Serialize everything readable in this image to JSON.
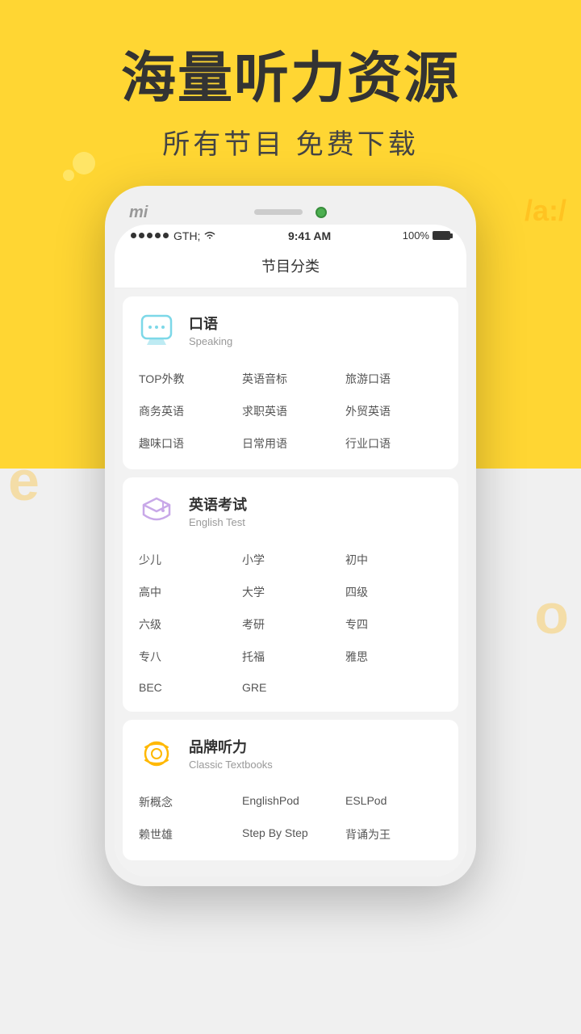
{
  "background": {
    "yellow": "#FFD633",
    "deco_phonetic": "/a:/"
  },
  "header": {
    "title": "海量听力资源",
    "subtitle": "所有节目  免费下载"
  },
  "phone": {
    "mi_logo": "mi",
    "status_bar": {
      "time": "9:41 AM",
      "battery": "100%"
    },
    "page_title": "节目分类",
    "categories": [
      {
        "id": "speaking",
        "title_cn": "口语",
        "title_en": "Speaking",
        "icon_type": "speaking",
        "items": [
          "TOP外教",
          "英语音标",
          "旅游口语",
          "商务英语",
          "求职英语",
          "外贸英语",
          "趣味口语",
          "日常用语",
          "行业口语"
        ]
      },
      {
        "id": "english-test",
        "title_cn": "英语考试",
        "title_en": "English Test",
        "icon_type": "exam",
        "items": [
          "少儿",
          "小学",
          "初中",
          "高中",
          "大学",
          "四级",
          "六级",
          "考研",
          "专四",
          "专八",
          "托福",
          "雅思",
          "BEC",
          "GRE",
          ""
        ]
      },
      {
        "id": "brand",
        "title_cn": "品牌听力",
        "title_en": "Classic Textbooks",
        "icon_type": "brand",
        "items": [
          "新概念",
          "EnglishPod",
          "ESLPod",
          "赖世雄",
          "Step By Step",
          "背诵为王"
        ]
      }
    ]
  },
  "deco": {
    "letter_e": "e",
    "letter_o": "o",
    "phonetic_a": "/a:/"
  }
}
